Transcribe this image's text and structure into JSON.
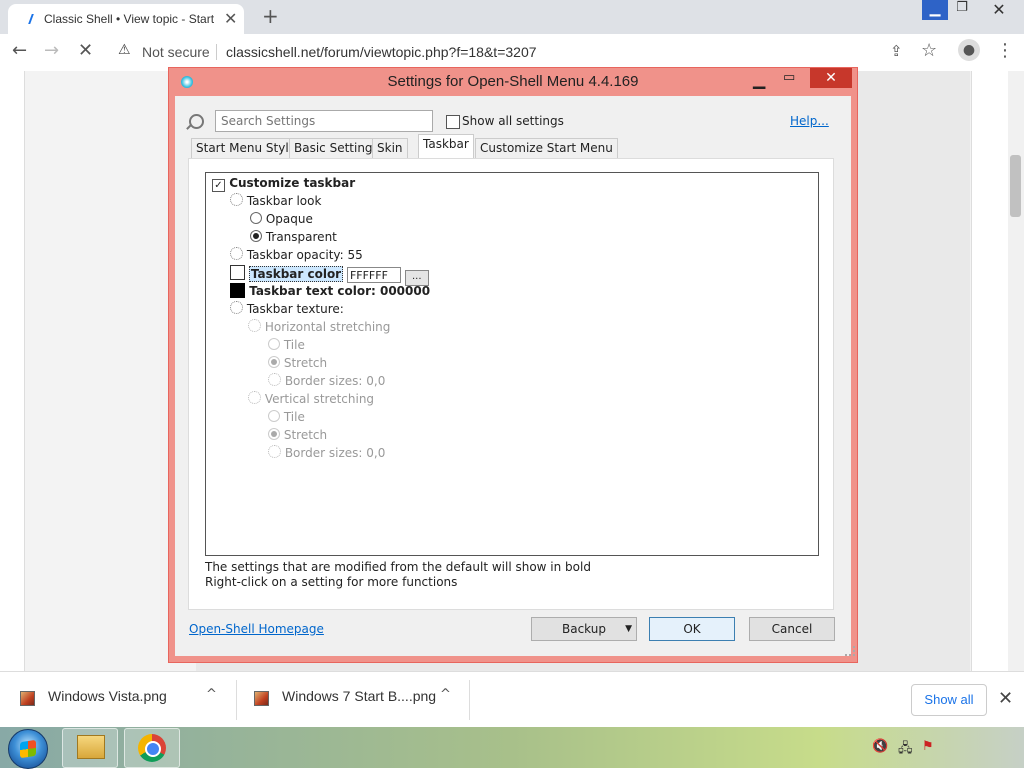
{
  "browser": {
    "tab_title": "Classic Shell • View topic - Start",
    "tab_close": "✕",
    "new_tab": "+",
    "security": "Not secure",
    "url": "classicshell.net/forum/viewtopic.php?f=18&t=3207",
    "window_min": "▁",
    "window_max": "❐",
    "window_close": "✕",
    "back": "←",
    "forward": "→",
    "reload": "✕",
    "share": "⇪",
    "star": "☆",
    "menu": "⋮"
  },
  "dialog": {
    "title": "Settings for Open-Shell Menu 4.4.169",
    "search_placeholder": "Search Settings",
    "show_all_label": "Show all settings",
    "help_link": "Help...",
    "tabs": [
      {
        "label": "Start Menu Style"
      },
      {
        "label": "Basic Settings"
      },
      {
        "label": "Skin"
      },
      {
        "label": "Taskbar"
      },
      {
        "label": "Customize Start Menu"
      }
    ],
    "active_tab": "Taskbar",
    "tree": {
      "customize_taskbar": "Customize taskbar",
      "taskbar_look": "Taskbar look",
      "opaque": "Opaque",
      "transparent": "Transparent",
      "opacity": "Taskbar opacity: 55",
      "color_label": "Taskbar color",
      "color_value": "FFFFFF",
      "browse": "...",
      "text_color": "Taskbar text color: 000000",
      "texture": "Taskbar texture:",
      "horizontal": "Horizontal stretching",
      "h_tile": "Tile",
      "h_stretch": "Stretch",
      "h_border": "Border sizes: 0,0",
      "vertical": "Vertical stretching",
      "v_tile": "Tile",
      "v_stretch": "Stretch",
      "v_border": "Border sizes: 0,0"
    },
    "hint1": "The settings that are modified from the default will show in bold",
    "hint2": "Right-click on a setting for more functions",
    "homepage": "Open-Shell Homepage",
    "backup": "Backup",
    "ok": "OK",
    "cancel": "Cancel",
    "colors": {
      "title_bar": "#f0928a",
      "close_button": "#c7372b",
      "link": "#0066cc"
    }
  },
  "downloads": {
    "items": [
      {
        "name": "Windows Vista.png"
      },
      {
        "name": "Windows 7 Start B....png"
      }
    ],
    "show_all": "Show all",
    "close": "✕",
    "chevron": "^"
  },
  "taskbar": {
    "apps": [
      "start-orb",
      "file-explorer",
      "chrome"
    ],
    "tray_icons": [
      "volume-muted-icon",
      "network-icon",
      "action-center-icon"
    ]
  }
}
